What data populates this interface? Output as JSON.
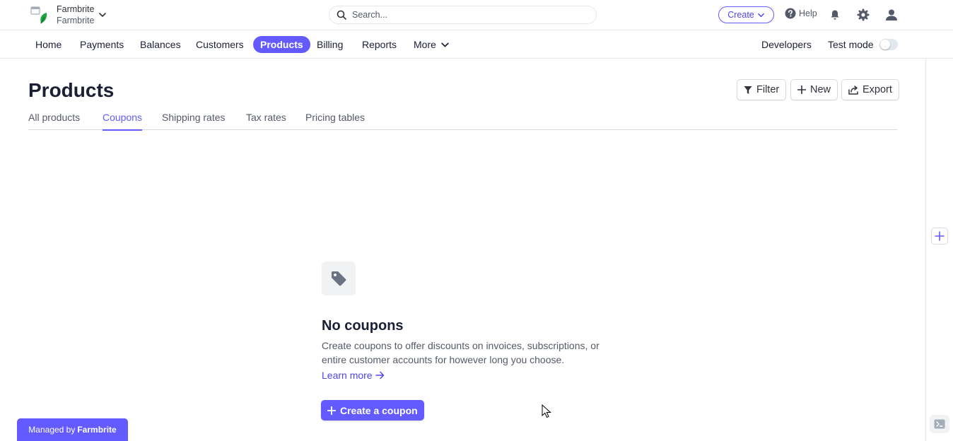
{
  "account": {
    "name": "Farmbrite",
    "subname": "Farmbrite"
  },
  "search": {
    "placeholder": "Search..."
  },
  "topbar": {
    "create_label": "Create",
    "help_label": "Help"
  },
  "nav": {
    "items": [
      {
        "label": "Home"
      },
      {
        "label": "Payments"
      },
      {
        "label": "Balances"
      },
      {
        "label": "Customers"
      },
      {
        "label": "Products",
        "active": true
      },
      {
        "label": "Billing"
      },
      {
        "label": "Reports"
      },
      {
        "label": "More"
      }
    ],
    "developers_label": "Developers",
    "test_mode_label": "Test mode",
    "test_mode_on": false
  },
  "page": {
    "title": "Products",
    "filter_label": "Filter",
    "new_label": "New",
    "export_label": "Export"
  },
  "tabs": [
    {
      "label": "All products"
    },
    {
      "label": "Coupons",
      "active": true
    },
    {
      "label": "Shipping rates"
    },
    {
      "label": "Tax rates"
    },
    {
      "label": "Pricing tables"
    }
  ],
  "empty_state": {
    "title": "No coupons",
    "description": "Create coupons to offer discounts on invoices, subscriptions, or entire customer accounts for however long you choose.",
    "learn_more": "Learn more",
    "cta_label": "Create a coupon"
  },
  "footer": {
    "managed_prefix": "Managed by",
    "managed_brand": "Farmbrite"
  },
  "colors": {
    "accent": "#635bff",
    "text": "#1a1f36",
    "muted": "#545969",
    "border": "#e3e8ee"
  },
  "icons": [
    "store-icon",
    "leaf-icon",
    "chevron-down-icon",
    "search-icon",
    "help-icon",
    "bell-icon",
    "gear-icon",
    "user-icon",
    "filter-icon",
    "plus-icon",
    "export-icon",
    "tag-icon",
    "arrow-right-icon",
    "terminal-icon"
  ]
}
